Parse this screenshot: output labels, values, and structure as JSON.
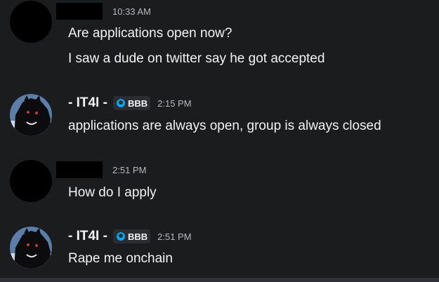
{
  "messages": [
    {
      "author": "",
      "time": "10:33 AM",
      "lines": [
        "Are applications open now?",
        "I saw a dude on twitter say he got accepted"
      ]
    },
    {
      "author": "- IT4I -",
      "tag": "BBB",
      "time": "2:15 PM",
      "lines": [
        "applications are always open, group is always closed"
      ]
    },
    {
      "author": "",
      "time": "2:51 PM",
      "lines": [
        "How do I apply"
      ]
    },
    {
      "author": "- IT4I -",
      "tag": "BBB",
      "time": "2:51 PM",
      "lines": [
        "Rape me onchain"
      ]
    }
  ],
  "colors": {
    "background": "#1a1c1e",
    "text": "#f2f3f5",
    "timestamp": "#b5bac1",
    "tag_icon": "#00a8fc"
  },
  "icons": {
    "tag_icon": "tag-badge-icon"
  }
}
